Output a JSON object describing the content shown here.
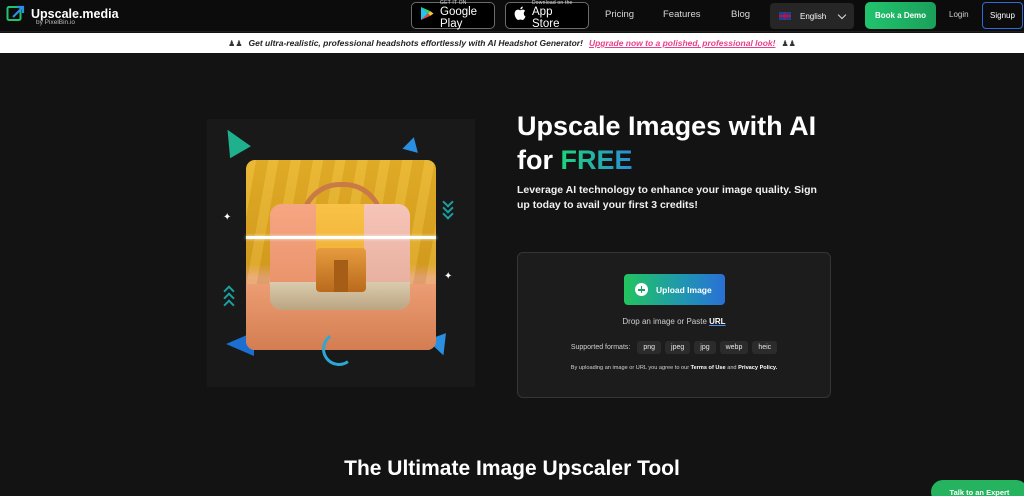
{
  "nav": {
    "logo_name": "Upscale.media",
    "logo_sub": "by PixelBin.io",
    "google_play": {
      "small": "GET IT ON",
      "big": "Google Play"
    },
    "app_store": {
      "small": "Download on the",
      "big": "App Store"
    },
    "links": [
      "Pricing",
      "Features",
      "Blog"
    ],
    "language": "English",
    "book_demo": "Book a Demo",
    "login": "Login",
    "signup": "Signup"
  },
  "banner": {
    "text": "Get ultra-realistic, professional headshots effortlessly with AI Headshot Generator!",
    "link": "Upgrade now to a polished, professional look!"
  },
  "hero": {
    "title_line1": "Upscale Images with AI",
    "title_for": "for ",
    "title_free": "FREE",
    "subtitle": "Leverage AI technology to enhance your image quality. Sign up today to avail your first 3 credits!"
  },
  "upload": {
    "button": "Upload Image",
    "drop_text": "Drop an image or Paste ",
    "drop_link": "URL",
    "formats_label": "Supported formats:",
    "formats": [
      "png",
      "jpeg",
      "jpg",
      "webp",
      "heic"
    ],
    "terms_prefix": "By uploading an image or URL you agree to our ",
    "terms_link": "Terms of Use",
    "terms_and": " and ",
    "privacy_link": "Privacy Policy."
  },
  "section_title": "The Ultimate Image Upscaler Tool",
  "chat": {
    "label": "Talk to an Expert"
  },
  "colors": {
    "accent_green": "#22c36e",
    "accent_blue": "#2a6fd6",
    "banner_link": "#e8408a",
    "background": "#131313"
  }
}
